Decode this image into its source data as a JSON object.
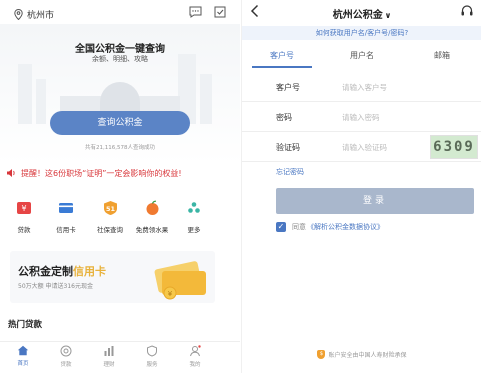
{
  "left": {
    "location": {
      "city": "杭州市",
      "icon": "location-pin-icon"
    },
    "top_icons": [
      "message-icon",
      "checkin-icon"
    ],
    "hero": {
      "title": "全国公积金一键查询",
      "subtitle": "余额、明细、攻略",
      "query_button": "查询公积金",
      "query_count": "共有21,116,578人查询成功"
    },
    "notice": "提醒！这6份职场“证明”一定会影响你的权益!",
    "services": [
      {
        "label": "贷款",
        "icon": "loan-icon",
        "color": "#e64545"
      },
      {
        "label": "信用卡",
        "icon": "credit-card-icon",
        "color": "#3a7bd5"
      },
      {
        "label": "社保查询",
        "icon": "social-security-icon",
        "color": "#f0a030"
      },
      {
        "label": "免费领水果",
        "icon": "fruit-icon",
        "color": "#f07a30"
      },
      {
        "label": "更多",
        "icon": "more-icon",
        "color": "#3ab5a5"
      }
    ],
    "promo": {
      "title_prefix": "公积金定制",
      "title_highlight": "信用卡",
      "subtitle": "50万大额 申请送316元现金"
    },
    "hot_loans_title": "热门贷款",
    "tabbar": [
      {
        "label": "首页",
        "icon": "home-icon",
        "active": true
      },
      {
        "label": "贷款",
        "icon": "loan-tab-icon",
        "active": false
      },
      {
        "label": "理财",
        "icon": "finance-icon",
        "active": false
      },
      {
        "label": "服务",
        "icon": "service-icon",
        "active": false
      },
      {
        "label": "我的",
        "icon": "profile-icon",
        "active": false
      }
    ]
  },
  "right": {
    "title": "杭州公积金",
    "title_caret": "∨",
    "help_link": "如何获取用户名/客户号/密码?",
    "tabs": [
      {
        "label": "客户号",
        "active": true
      },
      {
        "label": "用户名",
        "active": false
      },
      {
        "label": "邮箱",
        "active": false
      }
    ],
    "fields": [
      {
        "label": "客户号",
        "placeholder": "请输入客户号"
      },
      {
        "label": "密码",
        "placeholder": "请输入密码"
      },
      {
        "label": "验证码",
        "placeholder": "请输入验证码"
      }
    ],
    "captcha_text": "6309",
    "forgot_password": "忘记密码",
    "login_button": "登录",
    "agreement": {
      "prefix": "同意",
      "link": "《解析公积金数据协议》",
      "checked": true
    },
    "security_note": "账户安全由中国人寿财险承保",
    "security_badge": "$"
  }
}
